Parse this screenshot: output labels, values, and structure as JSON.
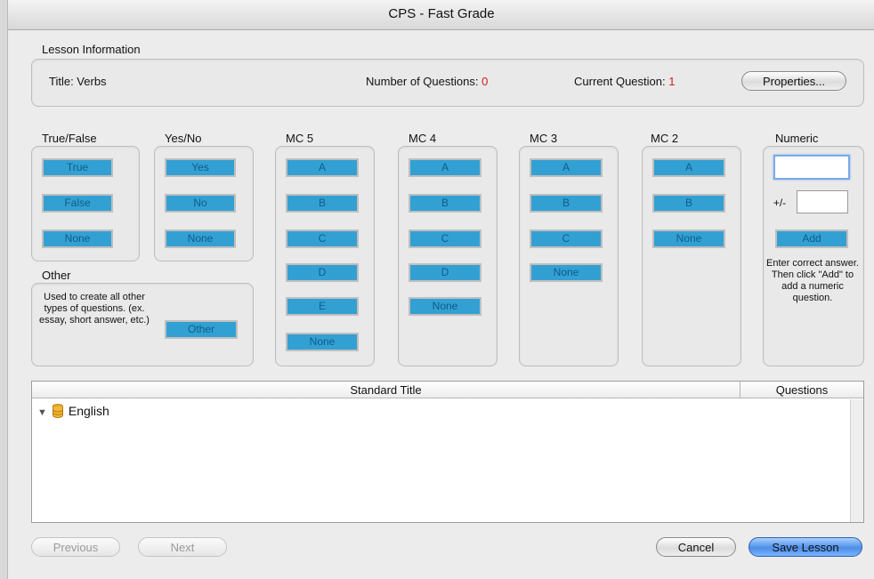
{
  "window": {
    "title": "CPS - Fast Grade"
  },
  "lesson_info": {
    "label": "Lesson Information",
    "title_label": "Title: Verbs",
    "num_questions_label": "Number of Questions:",
    "num_questions_value": "0",
    "current_question_label": "Current Question:",
    "current_question_value": "1",
    "properties_button": "Properties..."
  },
  "groups": {
    "true_false": {
      "label": "True/False",
      "buttons": [
        "True",
        "False",
        "None"
      ]
    },
    "yes_no": {
      "label": "Yes/No",
      "buttons": [
        "Yes",
        "No",
        "None"
      ]
    },
    "mc5": {
      "label": "MC 5",
      "buttons": [
        "A",
        "B",
        "C",
        "D",
        "E",
        "None"
      ]
    },
    "mc4": {
      "label": "MC 4",
      "buttons": [
        "A",
        "B",
        "C",
        "D",
        "None"
      ]
    },
    "mc3": {
      "label": "MC 3",
      "buttons": [
        "A",
        "B",
        "C",
        "None"
      ]
    },
    "mc2": {
      "label": "MC 2",
      "buttons": [
        "A",
        "B",
        "None"
      ]
    },
    "numeric": {
      "label": "Numeric",
      "plus_minus": "+/-",
      "add_button": "Add",
      "help_text": "Enter correct answer. Then click \"Add\" to add a numeric question.",
      "answer_value": "",
      "tolerance_value": ""
    },
    "other": {
      "label": "Other",
      "description": "Used to create all other types of questions. (ex. essay, short answer, etc.)",
      "button": "Other"
    }
  },
  "table": {
    "headers": [
      "Standard Title",
      "Questions"
    ],
    "rows": [
      {
        "label": "English",
        "expanded": true,
        "icon": "database-icon"
      }
    ]
  },
  "footer": {
    "previous": "Previous",
    "next": "Next",
    "cancel": "Cancel",
    "save": "Save Lesson"
  },
  "colors": {
    "answer_button": "#33a0d3",
    "accent_red": "#cc2020",
    "primary": "#4d8ee8"
  }
}
